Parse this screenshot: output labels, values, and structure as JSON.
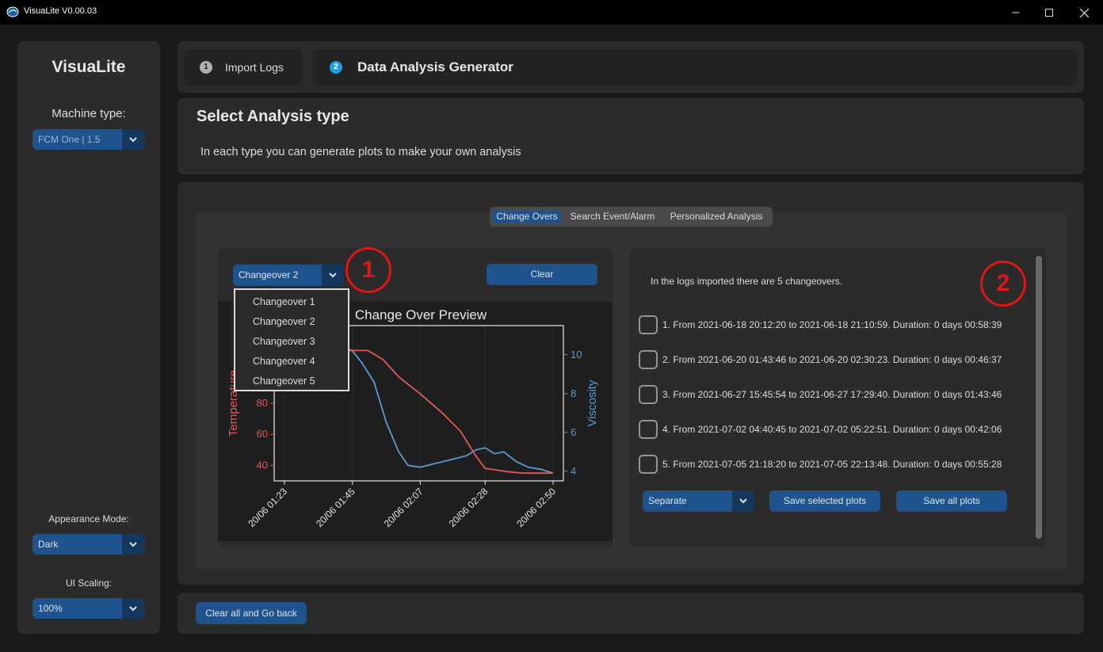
{
  "window": {
    "title": "VisuaLite V0.00.03"
  },
  "sidebar": {
    "logo": "VisuaLite",
    "machine_label": "Machine type:",
    "machine_value": "FCM One | 1.5",
    "appearance_label": "Appearance Mode:",
    "appearance_value": "Dark",
    "scaling_label": "UI Scaling:",
    "scaling_value": "100%"
  },
  "tabs": [
    {
      "num": "1",
      "label": "Import Logs"
    },
    {
      "num": "2",
      "label": "Data Analysis Generator"
    }
  ],
  "header": {
    "title": "Select Analysis type",
    "subtitle": "In each type you can generate plots to make your own analysis"
  },
  "segmented": [
    "Change Overs",
    "Search Event/Alarm",
    "Personalized Analysis"
  ],
  "left": {
    "selected": "Changeover 2",
    "clear_label": "Clear",
    "dropdown_items": [
      "Changeover 1",
      "Changeover 2",
      "Changeover 3",
      "Changeover 4",
      "Changeover 5"
    ]
  },
  "right": {
    "info": "In the logs imported there are 5 changeovers.",
    "changeovers": [
      "1. From 2021-06-18 20:12:20 to 2021-06-18 21:10:59. Duration: 0 days 00:58:39",
      "2. From 2021-06-20 01:43:46 to 2021-06-20 02:30:23. Duration: 0 days 00:46:37",
      "3. From 2021-06-27 15:45:54 to 2021-06-27 17:29:40. Duration: 0 days 01:43:46",
      "4. From 2021-07-02 04:40:45 to 2021-07-02 05:22:51. Duration: 0 days 00:42:06",
      "5. From 2021-07-05 21:18:20 to 2021-07-05 22:13:48. Duration: 0 days 00:55:28"
    ],
    "mode_value": "Separate",
    "save_selected_label": "Save selected plots",
    "save_all_label": "Save all plots"
  },
  "annotations": [
    "1",
    "2"
  ],
  "bottom": {
    "back_label": "Clear all and Go back"
  },
  "colors": {
    "accent": "#1f538d",
    "temperature": "#e05a5a",
    "viscosity": "#5b9bd5",
    "annotation": "#e01515"
  },
  "icons": {
    "app": "visualite-logo-icon",
    "dropdown": "chevron-down-icon",
    "min": "minimize-icon",
    "max": "maximize-icon",
    "close": "close-icon"
  },
  "chart_data": {
    "type": "line",
    "title": "Change Over Preview",
    "xlabel": "",
    "ylabel": "Temperature",
    "y2label": "Viscosity",
    "x_ticks": [
      "20/06 01:23",
      "20/06 01:45",
      "20/06 02:07",
      "20/06 02:28",
      "20/06 02:50"
    ],
    "y_ticks": [
      40,
      60,
      80
    ],
    "y2_ticks": [
      4,
      6,
      8,
      10
    ],
    "ylim": [
      30,
      130
    ],
    "y2lim": [
      3.5,
      11.5
    ],
    "series": [
      {
        "name": "Temperature",
        "axis": "left",
        "color": "#e05a5a",
        "x": [
          "01:23",
          "01:35",
          "01:40",
          "01:45",
          "01:50",
          "01:55",
          "02:00",
          "02:07",
          "02:14",
          "02:20",
          "02:25",
          "02:28",
          "02:35",
          "02:40",
          "02:45",
          "02:50"
        ],
        "values": [
          113,
          113,
          114,
          114,
          114,
          108,
          97,
          86,
          74,
          62,
          46,
          38,
          36,
          35,
          35,
          35
        ]
      },
      {
        "name": "Viscosity",
        "axis": "right",
        "color": "#5b9bd5",
        "x": [
          "01:23",
          "01:32",
          "01:40",
          "01:45",
          "01:48",
          "01:52",
          "01:56",
          "02:00",
          "02:03",
          "02:07",
          "02:12",
          "02:17",
          "02:22",
          "02:25",
          "02:28",
          "02:31",
          "02:34",
          "02:38",
          "02:42",
          "02:46",
          "02:50"
        ],
        "values": [
          10.5,
          10.6,
          10.6,
          10.2,
          9.6,
          8.6,
          6.5,
          5.0,
          4.3,
          4.2,
          4.4,
          4.6,
          4.8,
          5.1,
          5.2,
          4.9,
          5.0,
          4.5,
          4.2,
          4.1,
          3.9
        ]
      }
    ]
  }
}
